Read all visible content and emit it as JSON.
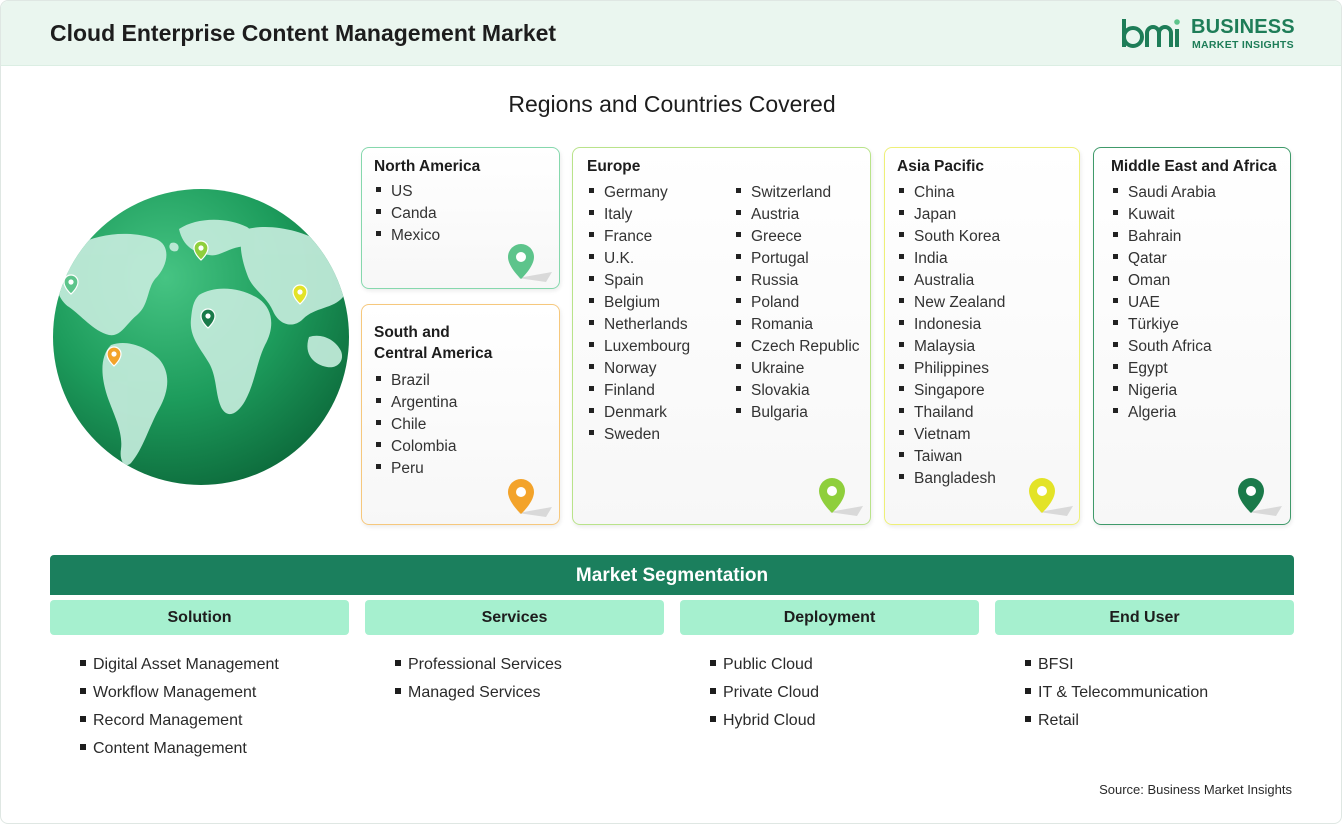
{
  "header": {
    "title": "Cloud Enterprise Content Management Market",
    "logo_line1": "BUSINESS",
    "logo_line2": "MARKET INSIGHTS"
  },
  "regions_title": "Regions and Countries Covered",
  "regions": {
    "north_america": {
      "title": "North America",
      "color": "#5dc48b",
      "items": [
        "US",
        "Canda",
        "Mexico"
      ]
    },
    "south_central_america": {
      "title_line1": "South and",
      "title_line2": "Central America",
      "color": "#f3a32a",
      "items": [
        "Brazil",
        "Argentina",
        "Chile",
        "Colombia",
        "Peru"
      ]
    },
    "europe": {
      "title": "Europe",
      "color": "#8fcf3c",
      "col1": [
        "Germany",
        "Italy",
        "France",
        "U.K.",
        "Spain",
        "Belgium",
        "Netherlands",
        "Luxembourg",
        "Norway",
        "Finland",
        "Denmark",
        "Sweden"
      ],
      "col2": [
        "Switzerland",
        "Austria",
        "Greece",
        "Portugal",
        "Russia",
        "Poland",
        "Romania",
        "Czech Republic",
        "Ukraine",
        "Slovakia",
        "Bulgaria"
      ]
    },
    "asia_pacific": {
      "title": "Asia Pacific",
      "color": "#e3e327",
      "items": [
        "China",
        "Japan",
        "South Korea",
        "India",
        "Australia",
        "New Zealand",
        "Indonesia",
        "Malaysia",
        "Philippines",
        "Singapore",
        "Thailand",
        "Vietnam",
        "Taiwan",
        "Bangladesh"
      ]
    },
    "middle_east_africa": {
      "title": "Middle East and Africa",
      "color": "#1a7a4a",
      "items": [
        "Saudi Arabia",
        "Kuwait",
        "Bahrain",
        "Qatar",
        "Oman",
        "UAE",
        "Türkiye",
        "South Africa",
        "Egypt",
        "Nigeria",
        "Algeria"
      ]
    }
  },
  "segmentation": {
    "title": "Market Segmentation",
    "columns": [
      {
        "label": "Solution",
        "items": [
          "Digital Asset Management",
          "Workflow Management",
          "Record Management",
          "Content Management"
        ]
      },
      {
        "label": "Services",
        "items": [
          "Professional Services",
          "Managed Services"
        ]
      },
      {
        "label": "Deployment",
        "items": [
          "Public Cloud",
          "Private Cloud",
          "Hybrid Cloud"
        ]
      },
      {
        "label": "End User",
        "items": [
          "BFSI",
          "IT & Telecommunication",
          "Retail"
        ]
      }
    ]
  },
  "source": "Source: Business Market Insights",
  "colors": {
    "header_bg": "#eaf6ef",
    "brand": "#1e7d58",
    "seg_bar": "#1b7f5d",
    "seg_head": "#a6f0cf",
    "globe_ocean": "#1d9c5c",
    "globe_land": "#c4ecdc"
  },
  "icons": {
    "pin": "map-pin-icon",
    "globe": "globe-icon",
    "logo": "bmi-logo-icon"
  }
}
